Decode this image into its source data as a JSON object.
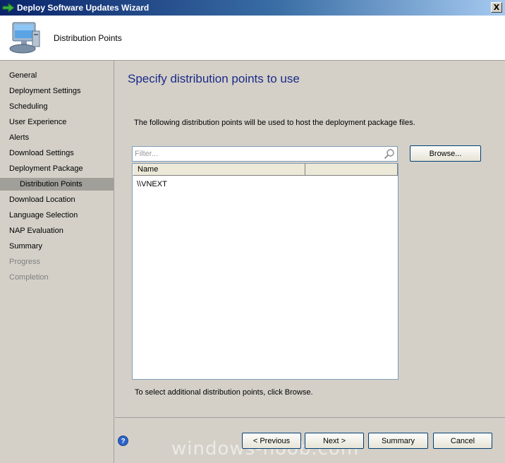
{
  "window": {
    "title": "Deploy Software Updates Wizard",
    "close_glyph": "X"
  },
  "header": {
    "title": "Distribution Points"
  },
  "sidebar": {
    "items": [
      {
        "label": "General",
        "state": "normal"
      },
      {
        "label": "Deployment Settings",
        "state": "normal"
      },
      {
        "label": "Scheduling",
        "state": "normal"
      },
      {
        "label": "User Experience",
        "state": "normal"
      },
      {
        "label": "Alerts",
        "state": "normal"
      },
      {
        "label": "Download Settings",
        "state": "normal"
      },
      {
        "label": "Deployment Package",
        "state": "normal"
      },
      {
        "label": "Distribution Points",
        "state": "active"
      },
      {
        "label": "Download Location",
        "state": "normal"
      },
      {
        "label": "Language Selection",
        "state": "normal"
      },
      {
        "label": "NAP Evaluation",
        "state": "normal"
      },
      {
        "label": "Summary",
        "state": "normal"
      },
      {
        "label": "Progress",
        "state": "disabled"
      },
      {
        "label": "Completion",
        "state": "disabled"
      }
    ]
  },
  "main": {
    "title": "Specify distribution points to use",
    "description": "The following distribution points will be used to host the deployment package files.",
    "filter": {
      "placeholder": "Filter..."
    },
    "browse_label": "Browse...",
    "list": {
      "columns": [
        "Name",
        ""
      ],
      "rows": [
        "\\\\VNEXT"
      ]
    },
    "hint": "To select additional distribution points, click Browse."
  },
  "footer": {
    "previous_label": "< Previous",
    "next_label": "Next >",
    "summary_label": "Summary",
    "cancel_label": "Cancel"
  },
  "watermark": "windows-noob.com",
  "colors": {
    "title_blue": "#1a2a88",
    "active_item": "#a19f9a"
  }
}
